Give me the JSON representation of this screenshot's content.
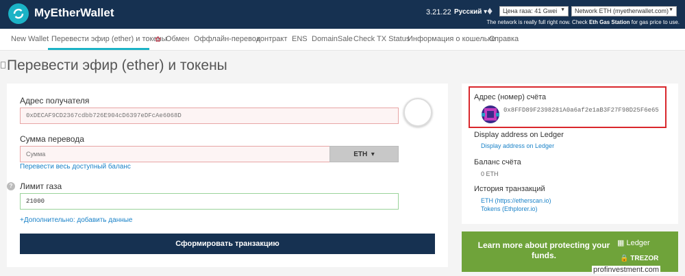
{
  "header": {
    "brand": "MyEtherWallet",
    "version": "3.21.22",
    "language": "Русский",
    "gas_price": "Цена газа: 41 Gwei",
    "network": "Network ETH (myetherwallet.com)",
    "note_prefix": "The network is really full right now. Check ",
    "note_link": "Eth Gas Station",
    "note_suffix": " for gas price to use."
  },
  "nav": {
    "items": [
      "New Wallet",
      "Перевести эфир (ether) и токены",
      "Обмен",
      "Оффлайн-перевод",
      "контракт",
      "ENS",
      "DomainSale",
      "Check TX Status",
      "Информация о кошельке",
      "Справка"
    ]
  },
  "page": {
    "title": "Перевести эфир (ether) и токены"
  },
  "form": {
    "recipient_label": "Адрес получателя",
    "recipient_placeholder": "0xDECAF9CD2367cdbb726E904cD6397eDFcAe6068D",
    "amount_label": "Сумма перевода",
    "amount_placeholder": "Сумма",
    "currency": "ETH",
    "send_all_link": "Перевести весь доступный баланс",
    "gas_label": "Лимит газа",
    "gas_value": "21000",
    "advanced_link": "+Дополнительно: добавить данные",
    "submit_label": "Сформировать транзакцию"
  },
  "sidebar": {
    "address_label": "Адрес (номер) счёта",
    "address_value": "0x8FFD89F2398281A0a6af2e1aB3F27F98D25F6e65",
    "ledger_label": "Display address on Ledger",
    "ledger_link": "Display address on Ledger",
    "balance_label": "Баланс счёта",
    "balance_value": "0 ETH",
    "history_label": "История транзакций",
    "history_links": [
      "ETH (https://etherscan.io)",
      "Tokens (Ethplorer.io)"
    ]
  },
  "promo": {
    "text": "Learn more about protecting your funds.",
    "brand_1": "Ledger",
    "brand_2": "TREZOR"
  },
  "watermark": "profinvestment.com",
  "colors": {
    "header_bg": "#163151",
    "accent": "#1bb3c6",
    "promo_bg": "#6fa33a",
    "highlight": "#d9262b"
  }
}
